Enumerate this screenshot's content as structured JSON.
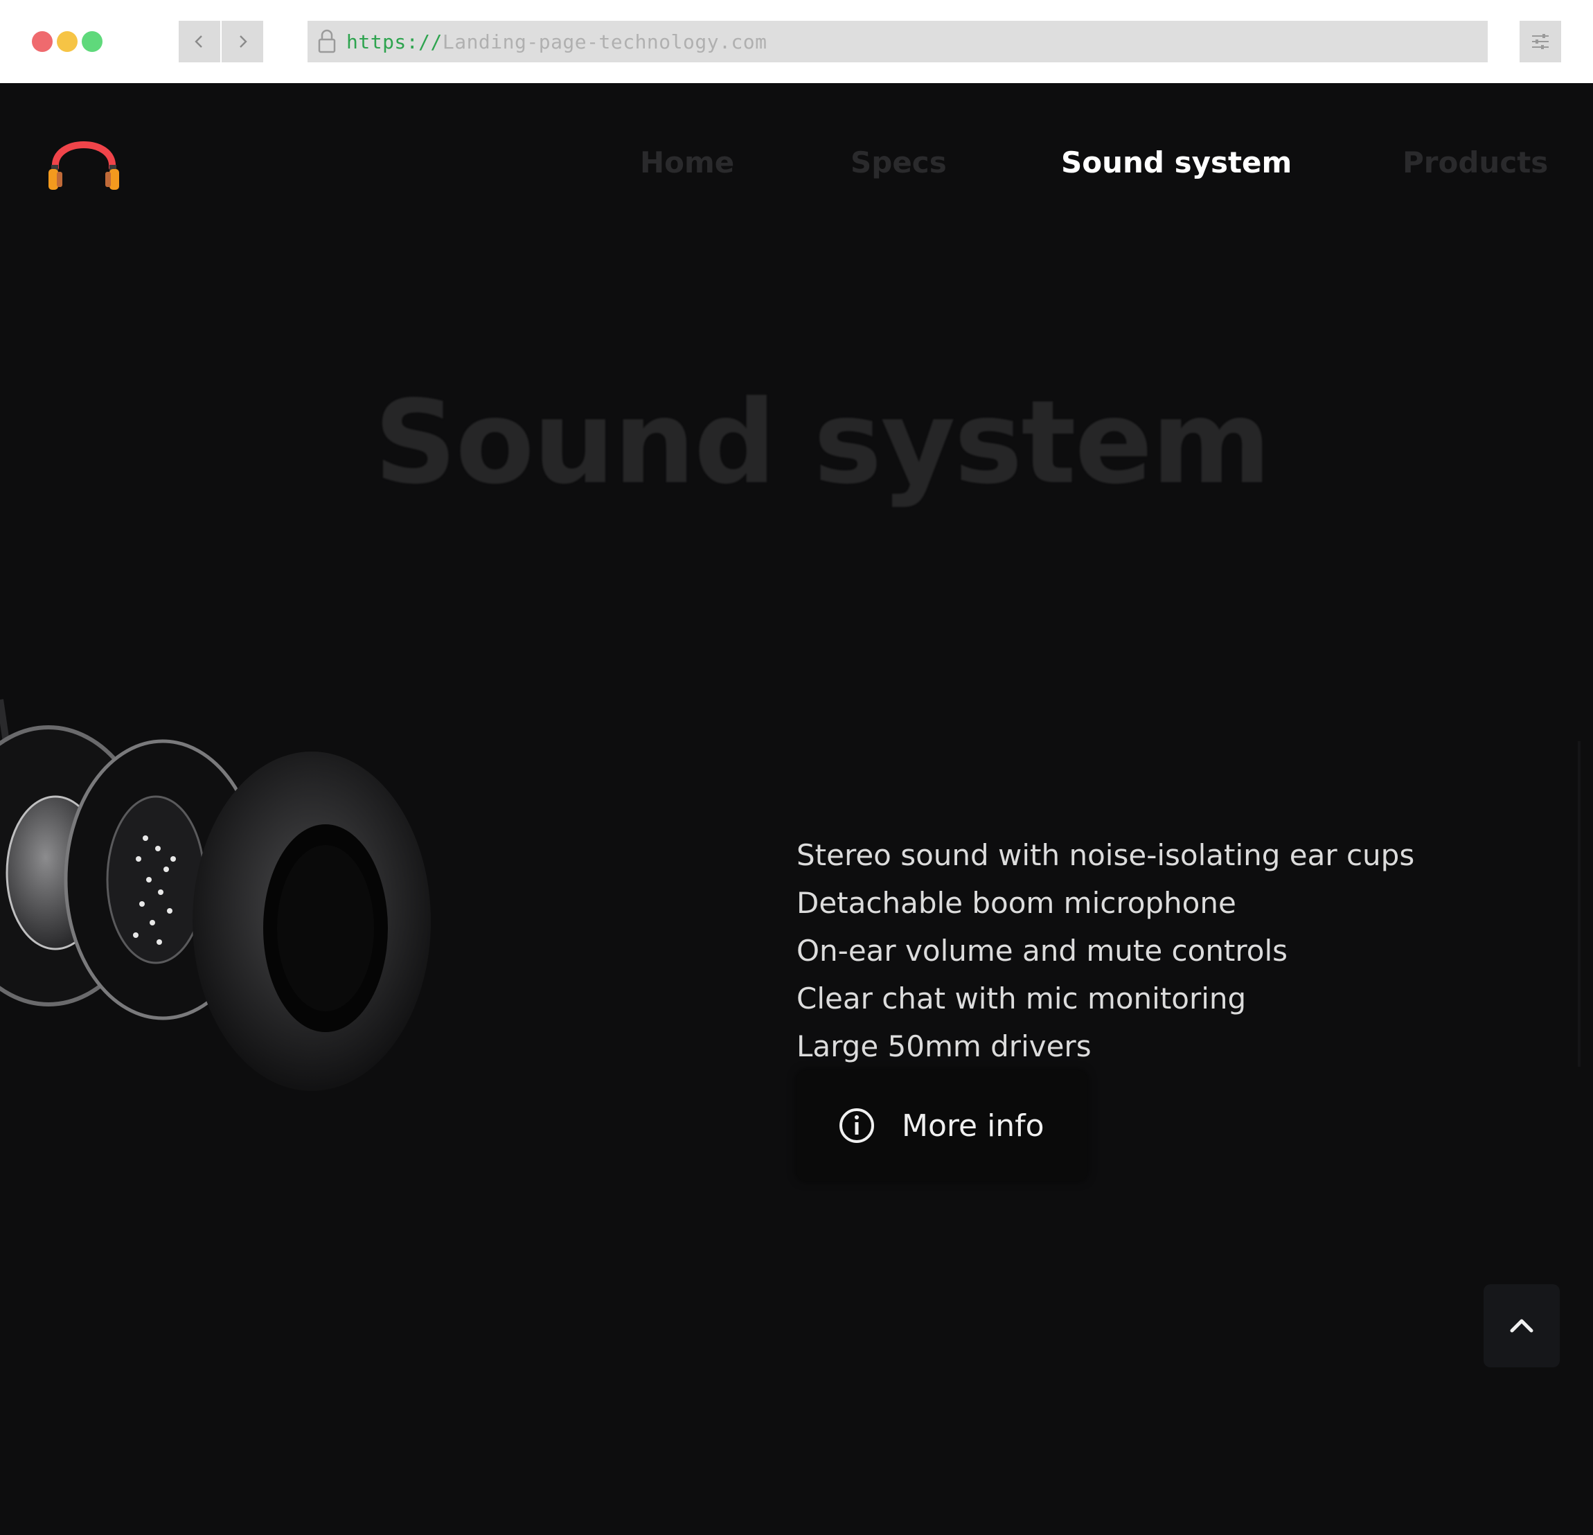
{
  "browser": {
    "url_scheme": "https://",
    "url_host": "Landing-page-technology.com",
    "colors": {
      "close": "#ef6a6e",
      "minimize": "#f6c445",
      "maximize": "#5fd97b",
      "scheme": "#2ea44f",
      "host": "#b0b0b0"
    }
  },
  "nav": {
    "links": [
      {
        "label": "Home",
        "color": "#2a2a2c"
      },
      {
        "label": "Specs",
        "color": "#2a2a2c"
      },
      {
        "label": "Sound system",
        "color": "#ffffff"
      },
      {
        "label": "Products",
        "color": "#2a2a2c"
      }
    ]
  },
  "hero": {
    "title": "Sound system",
    "features": [
      "Stereo sound with noise-isolating ear cups",
      "Detachable boom microphone",
      "On-ear volume and mute controls",
      "Clear chat with mic monitoring",
      "Large 50mm drivers"
    ],
    "button_label": "More info"
  },
  "icons": {
    "logo": "headphones-logo-icon",
    "info": "info-circle-icon",
    "up": "chevron-up-icon",
    "lock": "lock-icon",
    "back": "chevron-left-icon",
    "forward": "chevron-right-icon",
    "menu": "sliders-icon"
  }
}
